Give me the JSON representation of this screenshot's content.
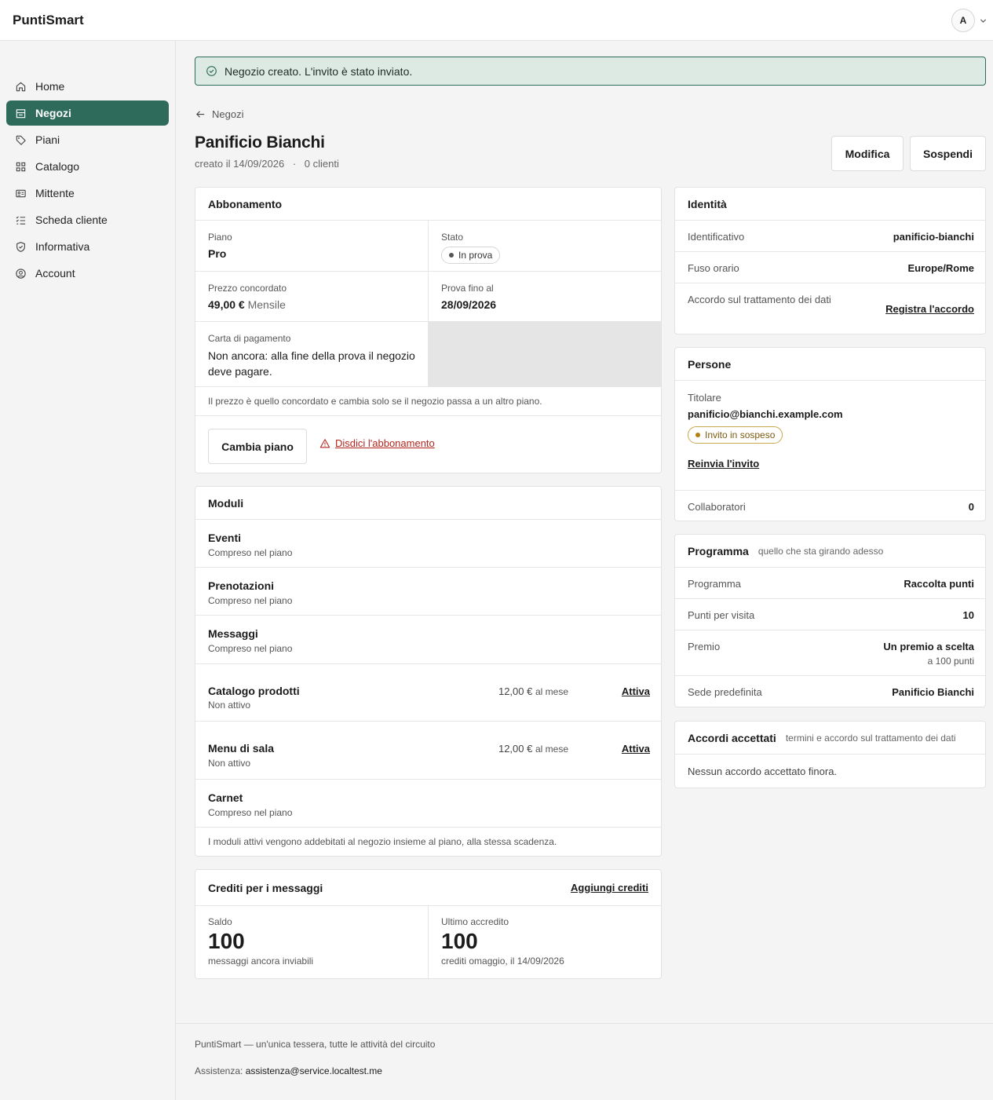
{
  "app": {
    "brand": "PuntiSmart",
    "avatar_initial": "A"
  },
  "sidebar": {
    "items": [
      {
        "label": "Home",
        "icon": "home-icon"
      },
      {
        "label": "Negozi",
        "icon": "store-icon",
        "active": true
      },
      {
        "label": "Piani",
        "icon": "tag-icon"
      },
      {
        "label": "Catalogo",
        "icon": "grid-icon"
      },
      {
        "label": "Mittente",
        "icon": "id-card-icon"
      },
      {
        "label": "Scheda cliente",
        "icon": "list-check-icon"
      },
      {
        "label": "Informativa",
        "icon": "shield-check-icon"
      },
      {
        "label": "Account",
        "icon": "user-circle-icon"
      }
    ]
  },
  "alert": {
    "text": "Negozio creato. L'invito è stato inviato."
  },
  "header": {
    "back_label": "Negozi",
    "title": "Panificio Bianchi",
    "created": "creato il 14/09/2026",
    "separator": "·",
    "clients": "0 clienti",
    "edit_label": "Modifica",
    "suspend_label": "Sospendi"
  },
  "subscription": {
    "title": "Abbonamento",
    "plan_label": "Piano",
    "plan_value": "Pro",
    "status_label": "Stato",
    "status_value": "In prova",
    "price_label": "Prezzo concordato",
    "price_value": "49,00 €",
    "price_period": "Mensile",
    "trial_label": "Prova fino al",
    "trial_value": "28/09/2026",
    "card_label": "Carta di pagamento",
    "card_value": "Non ancora: alla fine della prova il negozio deve pagare.",
    "note": "Il prezzo è quello concordato e cambia solo se il negozio passa a un altro piano.",
    "change_label": "Cambia piano",
    "cancel_label": "Disdici l'abbonamento"
  },
  "modules": {
    "title": "Moduli",
    "items": [
      {
        "name": "Eventi",
        "status": "Compreso nel piano"
      },
      {
        "name": "Prenotazioni",
        "status": "Compreso nel piano"
      },
      {
        "name": "Messaggi",
        "status": "Compreso nel piano"
      },
      {
        "name": "Catalogo prodotti",
        "status": "Non attivo",
        "price": "12,00 €",
        "period": "al mese",
        "action": "Attiva"
      },
      {
        "name": "Menu di sala",
        "status": "Non attivo",
        "price": "12,00 €",
        "period": "al mese",
        "action": "Attiva"
      },
      {
        "name": "Carnet",
        "status": "Compreso nel piano"
      }
    ],
    "note": "I moduli attivi vengono addebitati al negozio insieme al piano, alla stessa scadenza."
  },
  "credits": {
    "title": "Crediti per i messaggi",
    "add_label": "Aggiungi crediti",
    "balance_label": "Saldo",
    "balance_value": "100",
    "balance_sub": "messaggi ancora inviabili",
    "last_label": "Ultimo accredito",
    "last_value": "100",
    "last_sub": "crediti omaggio, il 14/09/2026"
  },
  "identity": {
    "title": "Identità",
    "id_label": "Identificativo",
    "id_value": "panificio-bianchi",
    "tz_label": "Fuso orario",
    "tz_value": "Europe/Rome",
    "dpa_label": "Accordo sul trattamento dei dati",
    "dpa_action": "Registra l'accordo"
  },
  "people": {
    "title": "Persone",
    "owner_label": "Titolare",
    "owner_email": "panificio@bianchi.example.com",
    "owner_status": "Invito in sospeso",
    "resend_label": "Reinvia l'invito",
    "collab_label": "Collaboratori",
    "collab_value": "0"
  },
  "program": {
    "title": "Programma",
    "hint": "quello che sta girando adesso",
    "type_label": "Programma",
    "type_value": "Raccolta punti",
    "points_label": "Punti per visita",
    "points_value": "10",
    "reward_label": "Premio",
    "reward_value": "Un premio a scelta",
    "reward_sub": "a 100 punti",
    "site_label": "Sede predefinita",
    "site_value": "Panificio Bianchi"
  },
  "agreements": {
    "title": "Accordi accettati",
    "hint": "termini e accordo sul trattamento dei dati",
    "empty": "Nessun accordo accettato finora."
  },
  "footer": {
    "tagline": "PuntiSmart — un'unica tessera, tutte le attività del circuito",
    "support_label": "Assistenza:",
    "support_email": "assistenza@service.localtest.me"
  },
  "colors": {
    "accent": "#2e6b5a",
    "alert_bg": "#dde9e3",
    "danger": "#b3261e",
    "warning": "#b07f10"
  }
}
